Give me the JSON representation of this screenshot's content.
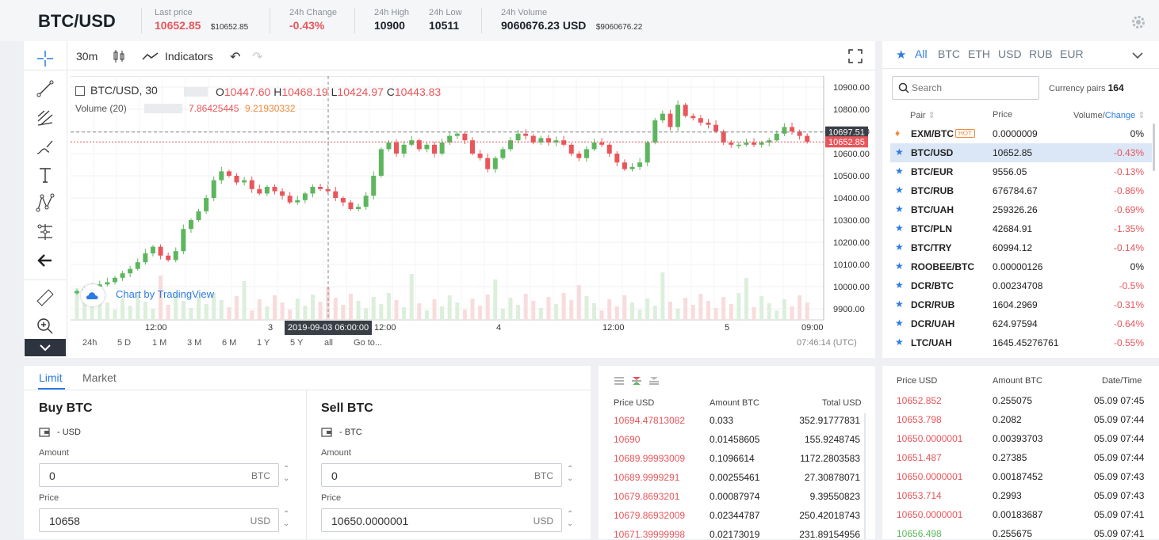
{
  "header": {
    "pair": "BTC/USD",
    "stats": [
      {
        "label": "Last price",
        "value": "10652.85",
        "sub": "$10652.85"
      },
      {
        "label": "24h Change",
        "value": "-0.43%"
      },
      {
        "label": "24h High",
        "value": "10900"
      },
      {
        "label": "24h Low",
        "value": "10511"
      },
      {
        "label": "24h Volume",
        "value": "9060676.23 USD",
        "sub": "$9060676.22"
      }
    ],
    "settings_icon": "gear-icon"
  },
  "chart": {
    "interval": "30m",
    "indicators_label": "Indicators",
    "symbol_line": "BTC/USD, 30",
    "ohlc": {
      "o_label": "O",
      "o": "10447.60",
      "h_label": "H",
      "h": "10468.19",
      "l_label": "L",
      "l": "10424.97",
      "c_label": "C",
      "c": "10443.83"
    },
    "volume_label": "Volume (20)",
    "volume_vals": [
      "7.86425445",
      "9.21930332"
    ],
    "watermark": "Chart by TradingView",
    "price_ticks": [
      "10900.00",
      "10800.00",
      "10700.00",
      "10600.00",
      "10500.00",
      "10400.00",
      "10300.00",
      "10200.00",
      "10100.00",
      "10000.00",
      "9900.00"
    ],
    "time_ticks": [
      "12:00",
      "3",
      "12:00",
      "4",
      "12:00",
      "5",
      "09:00"
    ],
    "crosshair_time": "2019-09-03 06:00:00",
    "price_tag_1": "10697.51",
    "price_tag_2": "10652.85",
    "timeframes": [
      "24h",
      "5 D",
      "1 M",
      "3 M",
      "6 M",
      "1 Y",
      "5 Y",
      "all",
      "Go to..."
    ],
    "clock": "07:46:14 (UTC)",
    "colors": {
      "up": "#5db65e",
      "down": "#e8565b",
      "accent": "#2c7be5"
    }
  },
  "chart_data": {
    "type": "candlestick",
    "ylim": [
      9850,
      10950
    ],
    "y_ticks": [
      9900,
      10000,
      10100,
      10200,
      10300,
      10400,
      10500,
      10600,
      10700,
      10800,
      10900
    ],
    "close": [
      9980,
      9990,
      10000,
      10010,
      10020,
      10040,
      10060,
      10080,
      10110,
      10150,
      10180,
      10140,
      10120,
      10160,
      10260,
      10300,
      10340,
      10400,
      10480,
      10520,
      10500,
      10470,
      10480,
      10440,
      10420,
      10450,
      10430,
      10410,
      10380,
      10390,
      10420,
      10450,
      10440,
      10430,
      10400,
      10380,
      10350,
      10360,
      10410,
      10500,
      10620,
      10650,
      10600,
      10640,
      10660,
      10620,
      10640,
      10600,
      10650,
      10680,
      10690,
      10660,
      10600,
      10580,
      10530,
      10580,
      10620,
      10660,
      10690,
      10680,
      10650,
      10670,
      10650,
      10660,
      10640,
      10600,
      10580,
      10620,
      10650,
      10640,
      10600,
      10560,
      10530,
      10540,
      10560,
      10650,
      10750,
      10780,
      10720,
      10820,
      10770,
      10760,
      10740,
      10730,
      10700,
      10650,
      10640,
      10640,
      10650,
      10640,
      10650,
      10660,
      10690,
      10720,
      10700,
      10680,
      10653
    ]
  },
  "tools": [
    "crosshair-icon",
    "trend-line-icon",
    "fib-icon",
    "brush-icon",
    "text-icon",
    "pattern-icon",
    "prediction-icon",
    "back-arrow-icon",
    "ruler-icon",
    "zoom-icon"
  ],
  "markets": {
    "tabs": [
      "All",
      "BTC",
      "ETH",
      "USD",
      "RUB",
      "EUR"
    ],
    "search_placeholder": "Search",
    "pairs_label": "Currency pairs",
    "pairs_count": "164",
    "col_pair": "Pair",
    "col_price": "Price",
    "col_volume": "Volume/",
    "col_change": "Change",
    "hot_badge": "HOT",
    "rows": [
      {
        "pair": "EXM/BTC",
        "price": "0.0000009",
        "change": "0%"
      },
      {
        "pair": "BTC/USD",
        "price": "10652.85",
        "change": "-0.43%"
      },
      {
        "pair": "BTC/EUR",
        "price": "9556.05",
        "change": "-0.13%"
      },
      {
        "pair": "BTC/RUB",
        "price": "676784.67",
        "change": "-0.86%"
      },
      {
        "pair": "BTC/UAH",
        "price": "259326.26",
        "change": "-0.69%"
      },
      {
        "pair": "BTC/PLN",
        "price": "42684.91",
        "change": "-1.35%"
      },
      {
        "pair": "BTC/TRY",
        "price": "60994.12",
        "change": "-0.14%"
      },
      {
        "pair": "ROOBEE/BTC",
        "price": "0.00000126",
        "change": "0%"
      },
      {
        "pair": "DCR/BTC",
        "price": "0.00234708",
        "change": "-0.5%"
      },
      {
        "pair": "DCR/RUB",
        "price": "1604.2969",
        "change": "-0.31%"
      },
      {
        "pair": "DCR/UAH",
        "price": "624.97594",
        "change": "-0.64%"
      },
      {
        "pair": "LTC/UAH",
        "price": "1645.45276761",
        "change": "-0.55%"
      }
    ]
  },
  "form": {
    "tabs": [
      "Limit",
      "Market"
    ],
    "buy": {
      "title": "Buy BTC",
      "balance": "- USD",
      "amount_label": "Amount",
      "amount": "0",
      "amount_unit": "BTC",
      "price_label": "Price",
      "price": "10658",
      "price_unit": "USD"
    },
    "sell": {
      "title": "Sell BTC",
      "balance": "- BTC",
      "amount_label": "Amount",
      "amount": "0",
      "amount_unit": "BTC",
      "price_label": "Price",
      "price": "10650.0000001",
      "price_unit": "USD"
    }
  },
  "orderbook": {
    "headers": [
      "Price USD",
      "Amount BTC",
      "Total USD"
    ],
    "rows": [
      {
        "price": "10694.47813082",
        "amount": "0.033",
        "total": "352.91777831"
      },
      {
        "price": "10690",
        "amount": "0.01458605",
        "total": "155.9248745"
      },
      {
        "price": "10689.99993009",
        "amount": "0.1096614",
        "total": "1172.2803583"
      },
      {
        "price": "10689.9999291",
        "amount": "0.00255461",
        "total": "27.30878071"
      },
      {
        "price": "10679.8693201",
        "amount": "0.00087974",
        "total": "9.39550823"
      },
      {
        "price": "10679.86932009",
        "amount": "0.02344787",
        "total": "250.42018743"
      },
      {
        "price": "10671.39999998",
        "amount": "0.02173019",
        "total": "231.89154956"
      }
    ]
  },
  "trades": {
    "headers": [
      "Price USD",
      "Amount BTC",
      "Date/Time"
    ],
    "rows": [
      {
        "price": "10652.852",
        "amount": "0.255075",
        "time": "05.09 07:45",
        "side": "sell"
      },
      {
        "price": "10653.798",
        "amount": "0.2082",
        "time": "05.09 07:44",
        "side": "sell"
      },
      {
        "price": "10650.0000001",
        "amount": "0.00393703",
        "time": "05.09 07:44",
        "side": "sell"
      },
      {
        "price": "10651.487",
        "amount": "0.27385",
        "time": "05.09 07:44",
        "side": "sell"
      },
      {
        "price": "10650.0000001",
        "amount": "0.00187452",
        "time": "05.09 07:43",
        "side": "sell"
      },
      {
        "price": "10653.714",
        "amount": "0.2993",
        "time": "05.09 07:43",
        "side": "sell"
      },
      {
        "price": "10650.0000001",
        "amount": "0.00183687",
        "time": "05.09 07:41",
        "side": "sell"
      },
      {
        "price": "10656.498",
        "amount": "0.255675",
        "time": "05.09 07:41",
        "side": "buy"
      }
    ]
  }
}
